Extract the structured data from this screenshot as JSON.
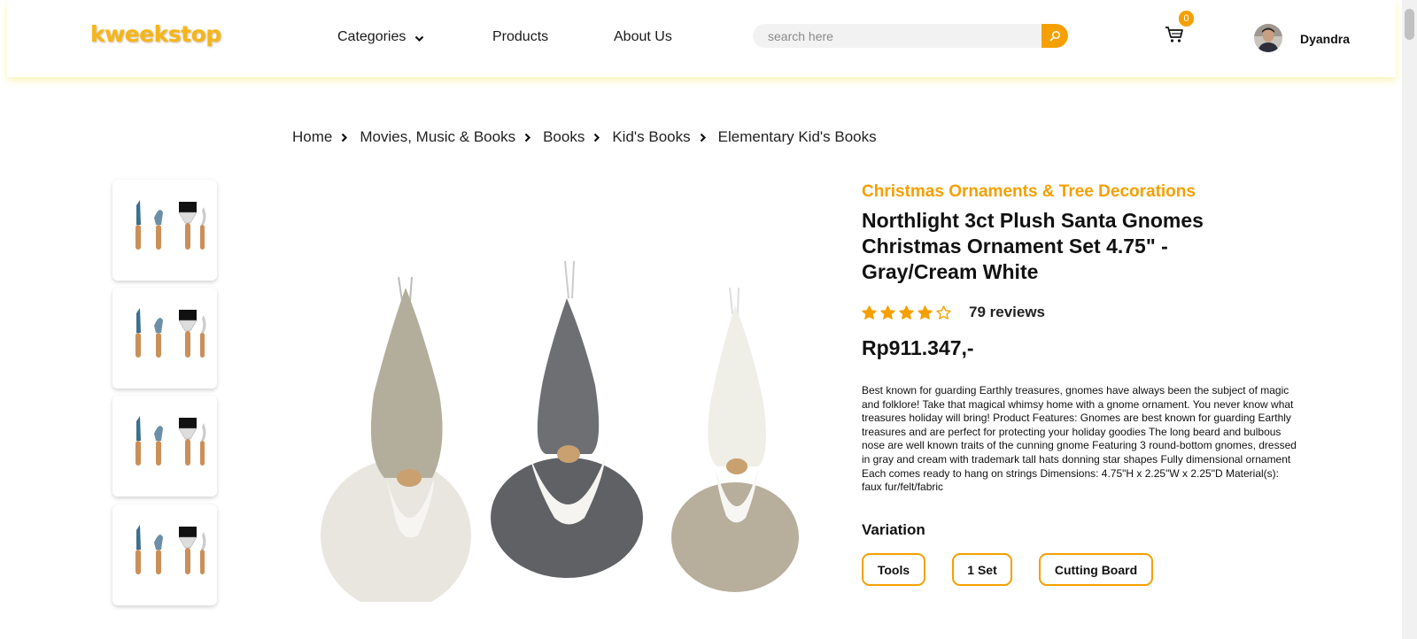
{
  "header": {
    "logo": "kweekstop",
    "nav": {
      "categories": "Categories",
      "products": "Products",
      "about": "About Us"
    },
    "search": {
      "placeholder": "search here",
      "value": ""
    },
    "cart": {
      "count": "0"
    },
    "user": {
      "name": "Dyandra"
    },
    "accent_color": "#f5a000",
    "logo_color": "#f5b51a"
  },
  "breadcrumb": [
    "Home",
    "Movies, Music & Books",
    "Books",
    "Kid's Books",
    "Elementary Kid's Books"
  ],
  "product": {
    "category": "Christmas Ornaments & Tree Decorations",
    "title": "Northlight 3ct Plush Santa Gnomes Christmas Ornament Set 4.75\" - Gray/Cream White",
    "rating": 4,
    "rating_max": 5,
    "reviews": "79 reviews",
    "price": "Rp911.347,-",
    "description": "Best known for guarding Earthly treasures, gnomes have always been the subject of magic and folklore! Take that magical whimsy home with a gnome ornament. You never know what treasures holiday will bring! Product Features: Gnomes are best known for guarding Earthly treasures and are perfect for protecting your holiday goodies The long beard and bulbous nose are well known traits of the cunning gnome Featuring 3 round-bottom gnomes, dressed in gray and cream with trademark tall hats donning star shapes Fully dimensional ornament Each comes ready to hang on strings Dimensions: 4.75\"H x 2.25\"W x 2.25\"D Material(s): faux fur/felt/fabric",
    "variation_label": "Variation",
    "variations": [
      "Tools",
      "1 Set",
      "Cutting Board"
    ]
  }
}
